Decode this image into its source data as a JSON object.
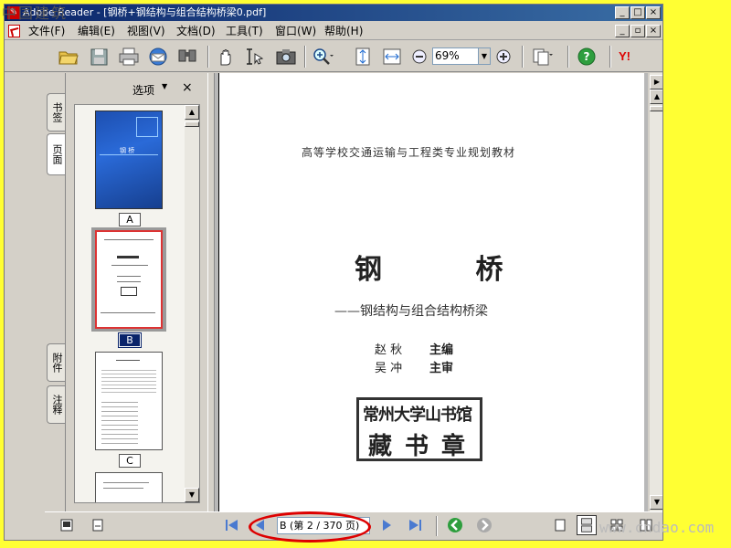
{
  "window": {
    "title": "Adobe Reader - [钢桥+钢结构与组合结构桥梁0.pdf]",
    "minimize": "_",
    "maximize": "□",
    "close": "×"
  },
  "menu": {
    "items": [
      "文件(F)",
      "编辑(E)",
      "视图(V)",
      "文档(D)",
      "工具(T)",
      "窗口(W)",
      "帮助(H)"
    ],
    "mdi_minimize": "_",
    "mdi_restore": "▫",
    "mdi_close": "×"
  },
  "toolbar": {
    "zoom_value": "69%",
    "icons": [
      "open-icon",
      "save-icon",
      "print-icon",
      "email-icon",
      "search-icon",
      "hand-icon",
      "select-text-icon",
      "snapshot-icon",
      "zoom-in-icon",
      "fit-page-icon",
      "fit-width-icon",
      "zoom-out-minus-icon",
      "zoom-in-plus-icon",
      "pages-icon",
      "help-icon",
      "yahoo-icon"
    ],
    "yahoo_label": "Y!"
  },
  "side_tabs": {
    "bookmarks": "书签",
    "pages": "页面",
    "attachments": "附件",
    "comments": "注释"
  },
  "panel": {
    "options_label": "选项",
    "close_label": "×",
    "thumbnails": [
      {
        "label": "A",
        "selected": false
      },
      {
        "label": "B",
        "selected": true
      },
      {
        "label": "C",
        "selected": false
      }
    ],
    "cover_title": "钢 桥"
  },
  "document": {
    "series": "高等学校交通运输与工程类专业规划教材",
    "title": "钢 桥",
    "subtitle": "——钢结构与组合结构桥梁",
    "authors": [
      {
        "name": "赵 秋",
        "role": "主编"
      },
      {
        "name": "吴 冲",
        "role": "主审"
      }
    ],
    "stamp_line1": "常州大学山书馆",
    "stamp_line2": "藏书章"
  },
  "statusbar": {
    "page_indicator": "B (第 2 / 370 页)"
  },
  "watermarks": {
    "top_left": "中国建筑",
    "bottom_right": "www.cndao.com"
  }
}
